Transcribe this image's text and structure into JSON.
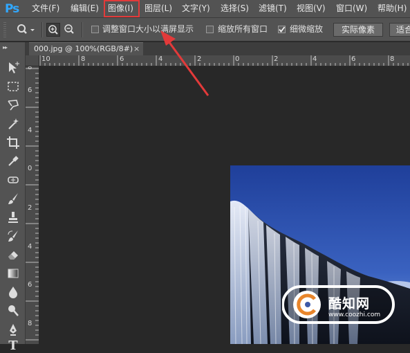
{
  "app": {
    "logo": "Ps"
  },
  "menubar": {
    "items": [
      "文件(F)",
      "编辑(E)",
      "图像(I)",
      "图层(L)",
      "文字(Y)",
      "选择(S)",
      "滤镜(T)",
      "视图(V)",
      "窗口(W)",
      "帮助(H)"
    ],
    "highlighted": "图像(I)"
  },
  "options": {
    "tool_icon": "zoom-tool-icon",
    "checkbox_resize": {
      "label": "调整窗口大小以满屏显示",
      "checked": false
    },
    "checkbox_zoom_all": {
      "label": "缩放所有窗口",
      "checked": false
    },
    "checkbox_scrubby": {
      "label": "细微缩放",
      "checked": true
    },
    "button_actual_pixels": "实际像素",
    "button_fit": "适合"
  },
  "document": {
    "tab_title": "000.jpg @ 100%(RGB/8#)",
    "close_symbol": "×",
    "ruler_top_labels": [
      "10",
      "8",
      "6",
      "4",
      "2",
      "0",
      "2",
      "4",
      "6",
      "8"
    ],
    "ruler_left_labels": [
      "8",
      "6",
      "4",
      "2",
      "0",
      "2",
      "4",
      "6",
      "8"
    ]
  },
  "tools": [
    "move-tool-icon",
    "marquee-tool-icon",
    "lasso-tool-icon",
    "magic-wand-tool-icon",
    "crop-tool-icon",
    "eyedropper-tool-icon",
    "healing-brush-tool-icon",
    "brush-tool-icon",
    "clone-stamp-tool-icon",
    "history-brush-tool-icon",
    "eraser-tool-icon",
    "gradient-tool-icon",
    "blur-tool-icon",
    "dodge-tool-icon",
    "pen-tool-icon",
    "type-tool-icon"
  ],
  "watermark": {
    "name": "酷知网",
    "url": "www.coozhi.com"
  },
  "colors": {
    "highlight": "#e23a3a",
    "ps_blue": "#31a8ff",
    "ui_gray": "#535353",
    "canvas": "#282828"
  }
}
